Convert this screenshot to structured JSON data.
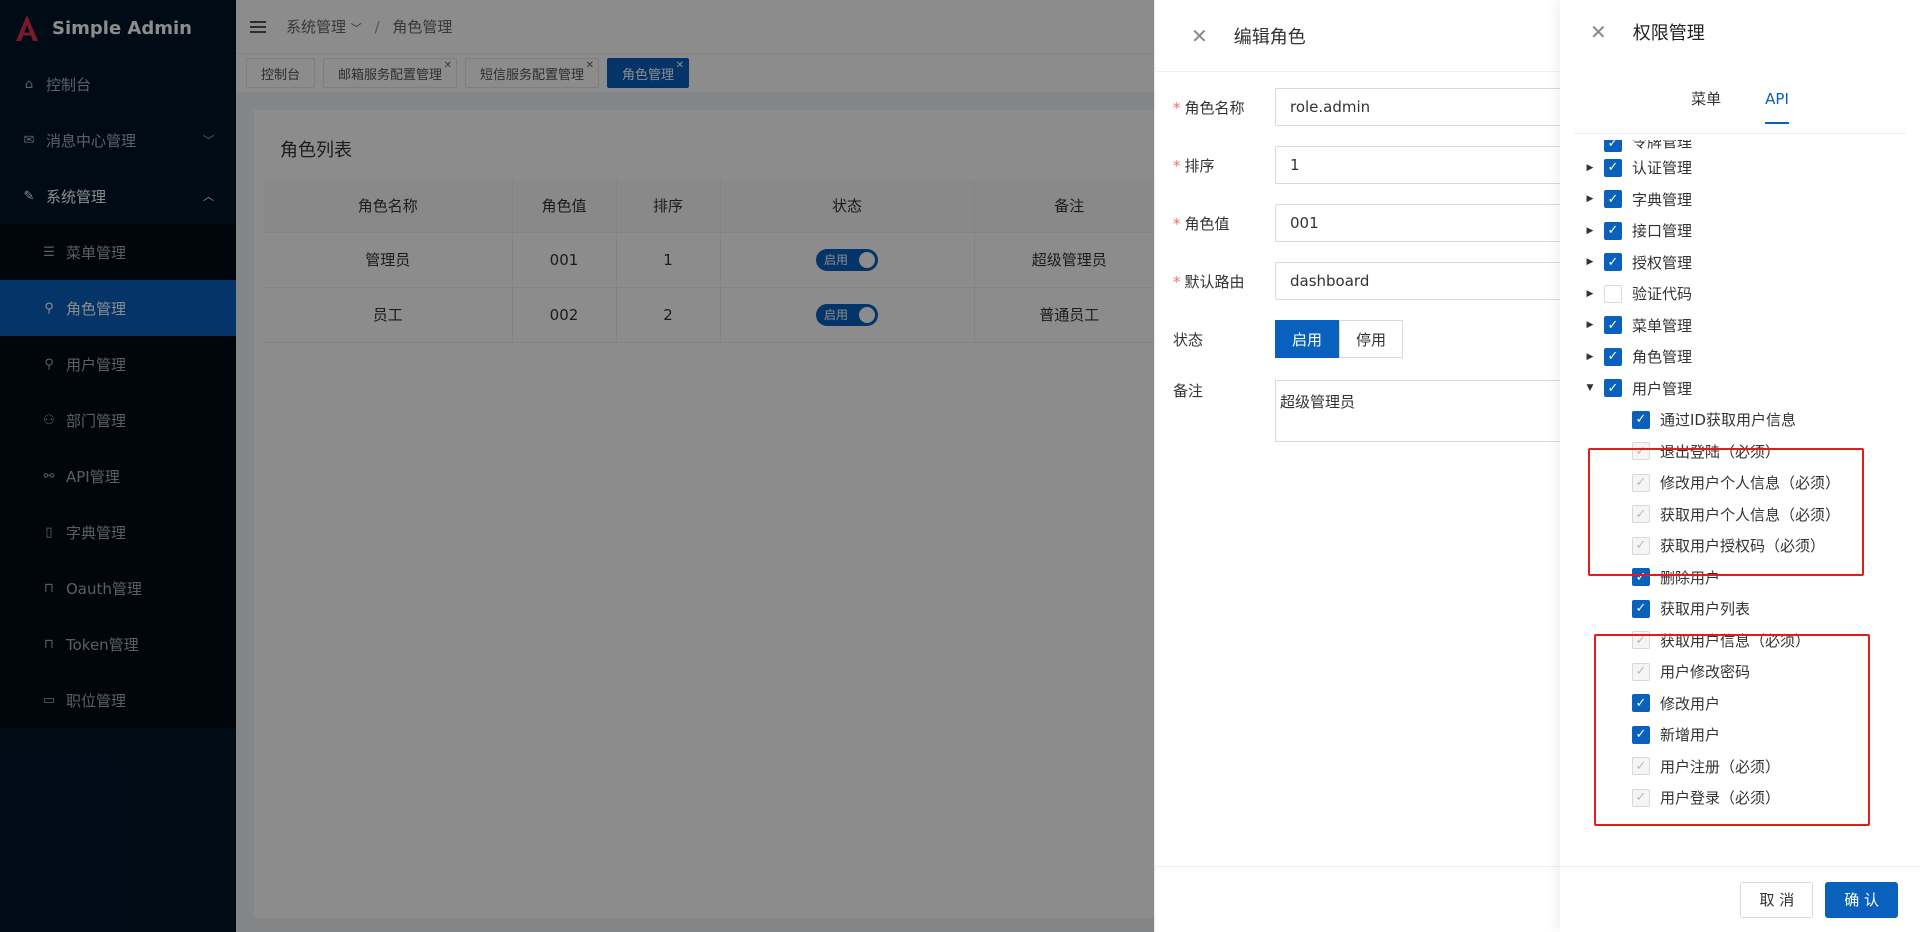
{
  "app": {
    "title": "Simple Admin"
  },
  "sidebar": {
    "items": [
      {
        "label": "控制台",
        "icon": "home-icon"
      },
      {
        "label": "消息中心管理",
        "icon": "mail-icon"
      },
      {
        "label": "系统管理",
        "icon": "wrench-icon"
      }
    ],
    "sub_items": [
      {
        "label": "菜单管理",
        "icon": "list-icon"
      },
      {
        "label": "角色管理",
        "icon": "user-icon",
        "active": true
      },
      {
        "label": "用户管理",
        "icon": "user-icon"
      },
      {
        "label": "部门管理",
        "icon": "team-icon"
      },
      {
        "label": "API管理",
        "icon": "api-icon"
      },
      {
        "label": "字典管理",
        "icon": "book-icon"
      },
      {
        "label": "Oauth管理",
        "icon": "lock-icon"
      },
      {
        "label": "Token管理",
        "icon": "lock-icon"
      },
      {
        "label": "职位管理",
        "icon": "briefcase-icon"
      }
    ]
  },
  "breadcrumb": {
    "parent": "系统管理",
    "current": "角色管理"
  },
  "tabs": [
    "控制台",
    "邮箱服务配置管理",
    "短信服务配置管理",
    "角色管理"
  ],
  "role_list": {
    "title": "角色列表",
    "columns": [
      "角色名称",
      "角色值",
      "排序",
      "状态",
      "备注"
    ],
    "rows": [
      {
        "name": "管理员",
        "value": "001",
        "sort": "1",
        "status": "启用",
        "remark": "超级管理员"
      },
      {
        "name": "员工",
        "value": "002",
        "sort": "2",
        "status": "启用",
        "remark": "普通员工"
      }
    ]
  },
  "edit_role": {
    "title": "编辑角色",
    "fields": {
      "name_label": "角色名称",
      "name_value": "role.admin",
      "sort_label": "排序",
      "sort_value": "1",
      "value_label": "角色值",
      "value_value": "001",
      "route_label": "默认路由",
      "route_value": "dashboard",
      "status_label": "状态",
      "status_on": "启用",
      "status_off": "停用",
      "remark_label": "备注",
      "remark_value": "超级管理员"
    }
  },
  "permission": {
    "title": "权限管理",
    "tabs": {
      "menu": "菜单",
      "api": "API"
    },
    "partial_top": "令牌管理",
    "top_nodes": [
      {
        "label": "认证管理",
        "state": "checked"
      },
      {
        "label": "字典管理",
        "state": "checked"
      },
      {
        "label": "接口管理",
        "state": "checked"
      },
      {
        "label": "授权管理",
        "state": "checked"
      },
      {
        "label": "验证代码",
        "state": "empty"
      },
      {
        "label": "菜单管理",
        "state": "checked"
      },
      {
        "label": "角色管理",
        "state": "checked"
      },
      {
        "label": "用户管理",
        "state": "checked",
        "expanded": true
      }
    ],
    "children": [
      {
        "label": "通过ID获取用户信息",
        "state": "checked"
      },
      {
        "label": "退出登陆（必须）",
        "state": "disabled"
      },
      {
        "label": "修改用户个人信息（必须）",
        "state": "disabled"
      },
      {
        "label": "获取用户个人信息（必须）",
        "state": "disabled"
      },
      {
        "label": "获取用户授权码（必须）",
        "state": "disabled"
      },
      {
        "label": "删除用户",
        "state": "checked"
      },
      {
        "label": "获取用户列表",
        "state": "checked"
      },
      {
        "label": "获取用户信息（必须）",
        "state": "disabled"
      },
      {
        "label": "用户修改密码",
        "state": "disabled"
      },
      {
        "label": "修改用户",
        "state": "checked"
      },
      {
        "label": "新增用户",
        "state": "checked"
      },
      {
        "label": "用户注册（必须）",
        "state": "disabled"
      },
      {
        "label": "用户登录（必须）",
        "state": "disabled"
      }
    ],
    "cancel": "取 消",
    "confirm": "确 认"
  },
  "colors": {
    "primary": "#0960bd",
    "sidebar": "#001529",
    "highlight": "#e41b1b"
  }
}
